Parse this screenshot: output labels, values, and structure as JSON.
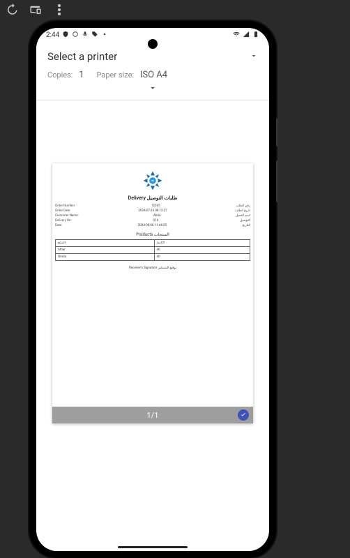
{
  "emulator_toolbar": {
    "icons": [
      "history-icon",
      "devices-icon",
      "more-icon"
    ]
  },
  "status": {
    "time": "2:44",
    "left_icons": [
      "shield-icon",
      "circle-icon",
      "mic-icon",
      "tag-icon",
      "dot-icon"
    ],
    "right_icons": [
      "wifi-icon",
      "signal-icon",
      "battery-icon"
    ]
  },
  "print": {
    "select_label": "Select a printer",
    "copies_label": "Copies:",
    "copies_value": "1",
    "paper_label": "Paper size:",
    "paper_value": "ISO A4"
  },
  "document": {
    "title": "Delivery طلبات التوصيل",
    "rows": [
      {
        "left": "Order Number:",
        "center": "12345",
        "right": "رقم الطلب"
      },
      {
        "left": "Order Date:",
        "center": "2024-07-23 08:12:27",
        "right": "تاريخ الطلب"
      },
      {
        "left": "Customer Name:",
        "center": "Abdo",
        "right": "اسم العميل"
      },
      {
        "left": "Delivery On:",
        "center": "014",
        "right": "التوصيل"
      },
      {
        "left": "Date:",
        "center": "2024-08-06 11:44:25",
        "right": "التاريخ"
      }
    ],
    "products_title": "Products المنتجات",
    "table": {
      "headers": [
        "المنتج",
        "الكمية"
      ],
      "rows": [
        [
          "Athar",
          "40"
        ],
        [
          "Omda",
          "40"
        ]
      ]
    },
    "signature_label": "Receiver's Signature: توقيع المستلم",
    "signature_dots": "..............................."
  },
  "footer": {
    "page_indicator": "1/1"
  }
}
